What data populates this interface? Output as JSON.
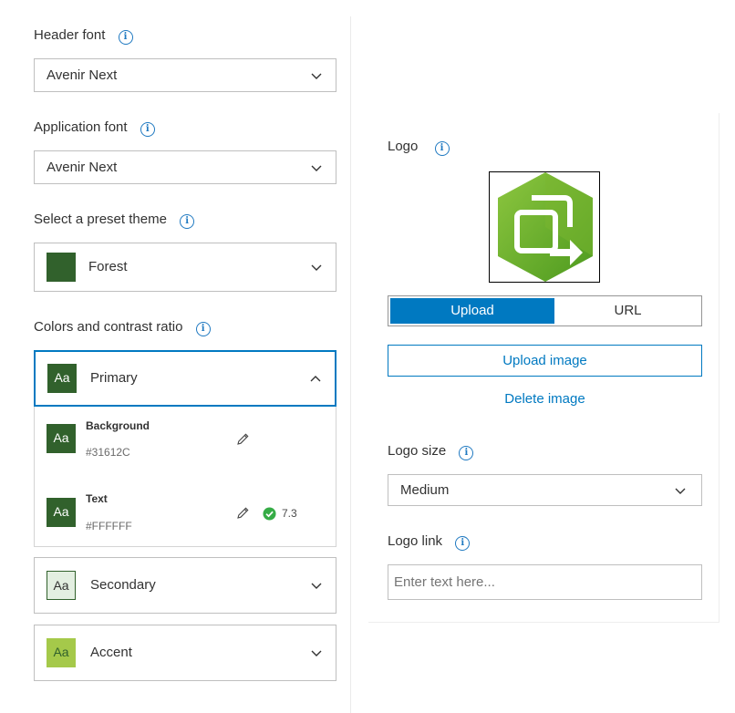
{
  "header_font": {
    "label": "Header font",
    "value": "Avenir Next"
  },
  "application_font": {
    "label": "Application font",
    "value": "Avenir Next"
  },
  "preset_theme": {
    "label": "Select a preset theme",
    "value": "Forest",
    "swatch_color": "#31612C"
  },
  "colors": {
    "label": "Colors and contrast ratio",
    "primary": {
      "label": "Primary",
      "swatch_text": "Aa",
      "swatch_color": "#31612C",
      "background": {
        "title": "Background",
        "hex": "#31612C"
      },
      "text": {
        "title": "Text",
        "hex": "#FFFFFF",
        "contrast": "7.3"
      }
    },
    "secondary": {
      "label": "Secondary",
      "swatch_text": "Aa",
      "swatch_color": "#E3EFE1"
    },
    "accent": {
      "label": "Accent",
      "swatch_text": "Aa",
      "swatch_color": "#A5C94A"
    }
  },
  "logo": {
    "label": "Logo",
    "tabs": {
      "upload": "Upload",
      "url": "URL",
      "selected": "Upload"
    },
    "upload_button": "Upload image",
    "delete_link": "Delete image",
    "size": {
      "label": "Logo size",
      "value": "Medium"
    },
    "link": {
      "label": "Logo link",
      "placeholder": "Enter text here..."
    }
  },
  "colors_ui": {
    "accent_blue": "#0079C1",
    "check_green": "#35AC46"
  }
}
